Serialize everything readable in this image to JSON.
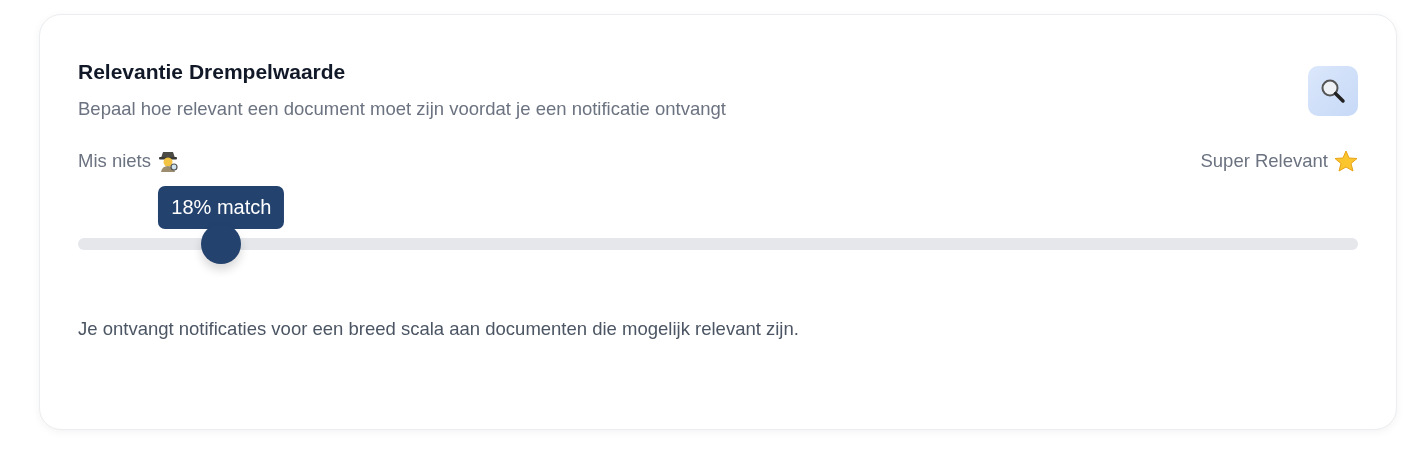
{
  "card": {
    "title": "Relevantie Drempelwaarde",
    "subtitle": "Bepaal hoe relevant een document moet zijn voordat je een notificatie ontvangt"
  },
  "slider": {
    "min_label": "Mis niets",
    "max_label": "Super Relevant",
    "level": 0.112,
    "tooltip": "18% match"
  },
  "description": "Je ontvangt notificaties voor een breed scala aan documenten die mogelijk relevant zijn."
}
